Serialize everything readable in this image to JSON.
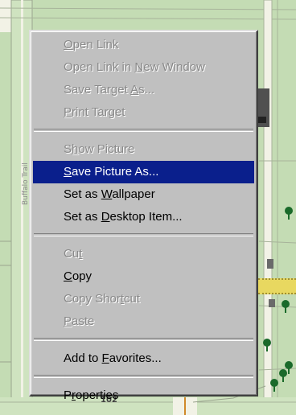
{
  "menu": {
    "groups": [
      [
        {
          "label": "Open Link",
          "mnemonic_index": 0,
          "enabled": false,
          "highlighted": false
        },
        {
          "label": "Open Link in New Window",
          "mnemonic_index": 13,
          "enabled": false,
          "highlighted": false
        },
        {
          "label": "Save Target As...",
          "mnemonic_index": 12,
          "enabled": false,
          "highlighted": false
        },
        {
          "label": "Print Target",
          "mnemonic_index": 0,
          "enabled": false,
          "highlighted": false
        }
      ],
      [
        {
          "label": "Show Picture",
          "mnemonic_index": 1,
          "enabled": false,
          "highlighted": false
        },
        {
          "label": "Save Picture As...",
          "mnemonic_index": 0,
          "enabled": true,
          "highlighted": true
        },
        {
          "label": "Set as Wallpaper",
          "mnemonic_index": 7,
          "enabled": true,
          "highlighted": false
        },
        {
          "label": "Set as Desktop Item...",
          "mnemonic_index": 7,
          "enabled": true,
          "highlighted": false
        }
      ],
      [
        {
          "label": "Cut",
          "mnemonic_index": 2,
          "enabled": false,
          "highlighted": false
        },
        {
          "label": "Copy",
          "mnemonic_index": 0,
          "enabled": true,
          "highlighted": false
        },
        {
          "label": "Copy Shortcut",
          "mnemonic_index": 9,
          "enabled": false,
          "highlighted": false
        },
        {
          "label": "Paste",
          "mnemonic_index": 0,
          "enabled": false,
          "highlighted": false
        }
      ],
      [
        {
          "label": "Add to Favorites...",
          "mnemonic_index": 7,
          "enabled": true,
          "highlighted": false
        }
      ],
      [
        {
          "label": "Properties",
          "mnemonic_index": 1,
          "enabled": true,
          "highlighted": false
        }
      ]
    ]
  },
  "map": {
    "street_label": "Buffalo Trail",
    "number_label": "102",
    "colors": {
      "park": "#c4dcb4",
      "road": "#f2f2e6",
      "building": "#505050",
      "highlight_building": "#e8d860",
      "tree": "#1a6a2a"
    }
  },
  "colors": {
    "menu_background": "#c0c0c0",
    "highlight": "#0a1f8c",
    "disabled_text": "#8a8a8a"
  }
}
